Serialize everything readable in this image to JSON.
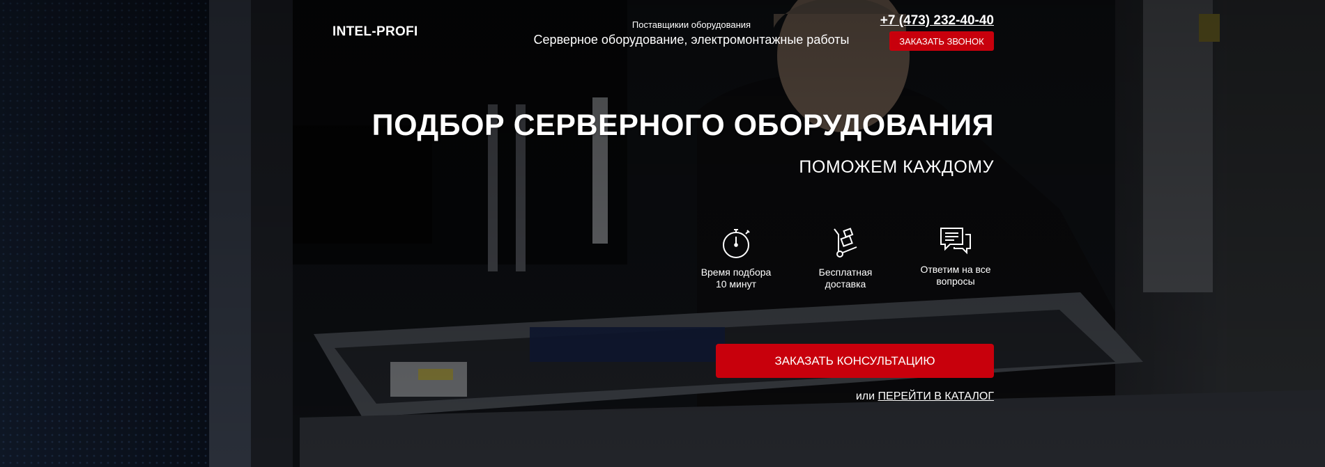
{
  "header": {
    "logo": "INTEL-PROFI",
    "tagline_small": "Поставщикии оборудования",
    "tagline_main": "Серверное оборудование, электромонтажные работы",
    "phone": "+7 (473) 232-40-40",
    "callback_label": "ЗАКАЗАТЬ ЗВОНОК"
  },
  "hero": {
    "title": "ПОДБОР СЕРВЕРНОГО ОБОРУДОВАНИЯ",
    "subtitle": "ПОМОЖЕМ КАЖДОМУ"
  },
  "features": [
    {
      "icon": "stopwatch-icon",
      "line1": "Время подбора",
      "line2": "10 минут"
    },
    {
      "icon": "hand-truck-icon",
      "line1": "Бесплатная",
      "line2": "доставка"
    },
    {
      "icon": "chat-bubbles-icon",
      "line1": "Ответим на все",
      "line2": "вопросы"
    }
  ],
  "cta": {
    "label": "ЗАКАЗАТЬ КОНСУЛЬТАЦИЮ",
    "or_text": "или",
    "catalog_link": "ПЕРЕЙТИ В КАТАЛОГ"
  },
  "colors": {
    "accent": "#c8000c",
    "text": "#ffffff",
    "overlay": "#000000"
  }
}
